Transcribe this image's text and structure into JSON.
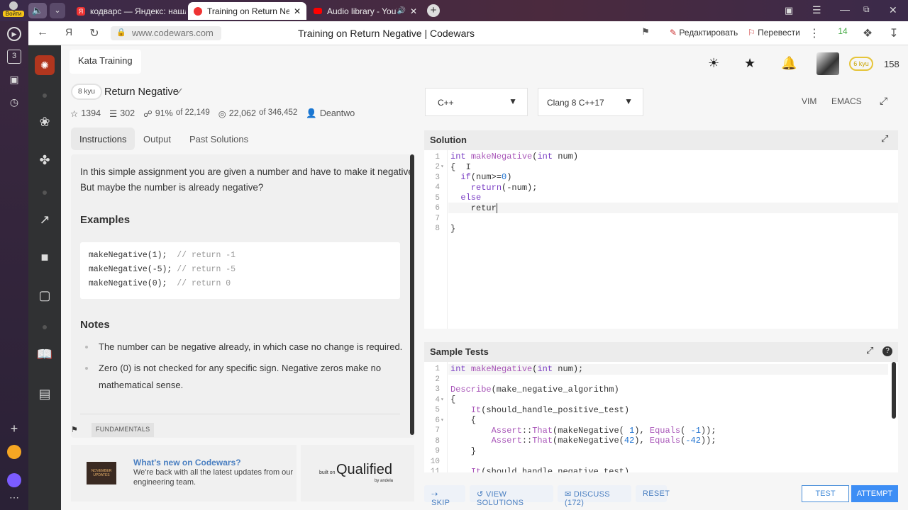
{
  "browser": {
    "profile_label": "Войти",
    "tabs": [
      {
        "title": "кодварс — Яндекс: нашл"
      },
      {
        "title": "Training on Return Nega"
      },
      {
        "title": "Audio library - YouTu"
      }
    ],
    "url": "www.codewars.com",
    "page_title": "Training on Return Negative | Codewars",
    "edit_btn": "Редактировать",
    "translate_btn": "Перевести",
    "sidebar_badge": "3",
    "ext_badge": "14"
  },
  "header": {
    "breadcrumb": "Kata Training",
    "rank_badge": "6 kyu",
    "honor": "158"
  },
  "kata": {
    "kyu": "8 kyu",
    "title": "Return Negative",
    "stars": "1394",
    "collections": "302",
    "satisfaction": "91%",
    "satisfaction_of": "of 22,149",
    "completed": "22,062",
    "completed_of": "of 346,452",
    "author": "Deantwo"
  },
  "left_tabs": [
    "Instructions",
    "Output",
    "Past Solutions"
  ],
  "instructions": {
    "intro_line1": "In this simple assignment you are given a number and have to make it negative.",
    "intro_line2": "But maybe the number is already negative?",
    "examples_heading": "Examples",
    "examples": [
      {
        "code": "makeNegative(1);  ",
        "comment": "// return -1"
      },
      {
        "code": "makeNegative(-5); ",
        "comment": "// return -5"
      },
      {
        "code": "makeNegative(0);  ",
        "comment": "// return 0"
      }
    ],
    "notes_heading": "Notes",
    "note1": "The number can be negative already, in which case no change is required.",
    "note2_line1": "Zero (0) is not checked for any specific sign. Negative zeros make no",
    "note2_line2": "mathematical sense.",
    "tag": "FUNDAMENTALS"
  },
  "promo": {
    "title": "What's new on Codewars?",
    "line1": "We're back with all the latest updates from our",
    "line2": "engineering team.",
    "thumb_text": "NOVEMBER UPDATES",
    "built_on": "built on",
    "brand": "Qualified",
    "by": "by andela"
  },
  "editor_toolbar": {
    "language": "C++",
    "version": "Clang 8 C++17",
    "vim": "VIM",
    "emacs": "EMACS"
  },
  "solution": {
    "title": "Solution",
    "line_numbers": [
      "1",
      "2",
      "3",
      "4",
      "5",
      "6",
      "7",
      "8"
    ]
  },
  "tests": {
    "title": "Sample Tests",
    "line_numbers": [
      "1",
      "2",
      "3",
      "4",
      "5",
      "6",
      "7",
      "8",
      "9",
      "10",
      "11"
    ]
  },
  "bottom": {
    "skip": "SKIP",
    "view_solutions": "VIEW SOLUTIONS",
    "discuss": "DISCUSS (172)",
    "reset": "RESET",
    "test": "TEST",
    "attempt": "ATTEMPT"
  }
}
